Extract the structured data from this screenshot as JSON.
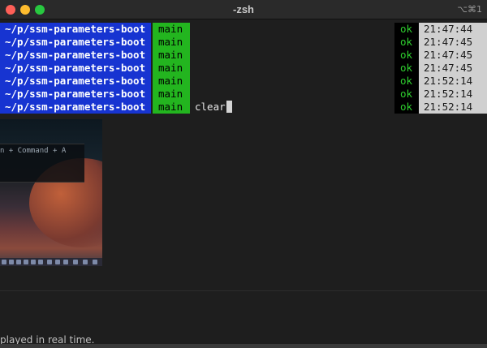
{
  "window": {
    "title": "-zsh",
    "shortcut": "⌥⌘1",
    "close_color": "#fe5f57",
    "minimize_color": "#febc2e",
    "zoom_color": "#28c840"
  },
  "terminal": {
    "rows": [
      {
        "path": "~/p/ssm-parameters-boot",
        "branch": "main",
        "command": "",
        "status": "ok",
        "time": "21:47:44"
      },
      {
        "path": "~/p/ssm-parameters-boot",
        "branch": "main",
        "command": "",
        "status": "ok",
        "time": "21:47:45"
      },
      {
        "path": "~/p/ssm-parameters-boot",
        "branch": "main",
        "command": "",
        "status": "ok",
        "time": "21:47:45"
      },
      {
        "path": "~/p/ssm-parameters-boot",
        "branch": "main",
        "command": "",
        "status": "ok",
        "time": "21:47:45"
      },
      {
        "path": "~/p/ssm-parameters-boot",
        "branch": "main",
        "command": "",
        "status": "ok",
        "time": "21:52:14"
      },
      {
        "path": "~/p/ssm-parameters-boot",
        "branch": "main",
        "command": "",
        "status": "ok",
        "time": "21:52:14"
      },
      {
        "path": "~/p/ssm-parameters-boot",
        "branch": "main",
        "command": "clear",
        "status": "ok",
        "time": "21:52:14"
      }
    ],
    "colors": {
      "path_bg": "#1734d1",
      "branch_bg": "#23b51f",
      "status_fg": "#2fd02f",
      "time_bg": "#d0d0d0"
    }
  },
  "background_image": {
    "shortcut_text": "n + Command + A"
  },
  "bottom_text": "played in real time."
}
